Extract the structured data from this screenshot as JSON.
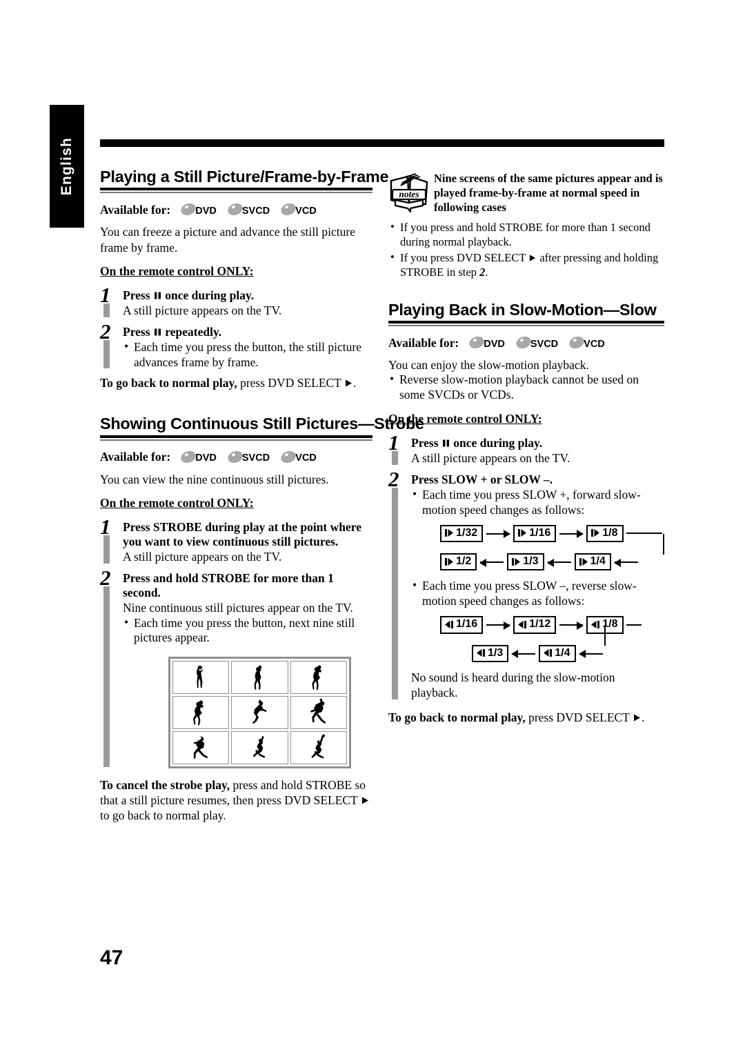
{
  "page": {
    "language_tab": "English",
    "page_number": "47"
  },
  "icons": {
    "disc": "disc-icon",
    "notes": "notes-icon",
    "pause": "pause-icon",
    "play": "play-triangle-icon",
    "slow_forward": "slow-forward-icon",
    "slow_reverse": "slow-reverse-icon"
  },
  "left_column": {
    "section1": {
      "heading": "Playing a Still Picture/Frame-by-Frame",
      "available_label": "Available for:",
      "available_discs": [
        "DVD",
        "SVCD",
        "VCD"
      ],
      "intro": "You can freeze a picture and advance the still picture frame by frame.",
      "remote_only": "On the remote control ONLY:",
      "steps": [
        {
          "num": "1",
          "title_pre": "Press ",
          "title_post": " once during play.",
          "sub": "A still picture appears on the TV.",
          "bullets": []
        },
        {
          "num": "2",
          "title_pre": "Press ",
          "title_post": " repeatedly.",
          "sub": "",
          "bullets": [
            "Each time you press the button, the still picture advances frame by frame."
          ]
        }
      ],
      "footnote_bold": "To go back to normal play,",
      "footnote_rest_pre": " press DVD SELECT ",
      "footnote_rest_post": "."
    },
    "section2": {
      "heading": "Showing Continuous Still Pictures—Strobe",
      "available_label": "Available for:",
      "available_discs": [
        "DVD",
        "SVCD",
        "VCD"
      ],
      "intro": "You can view the nine continuous still pictures.",
      "remote_only": "On the remote control ONLY:",
      "steps": [
        {
          "num": "1",
          "title": "Press STROBE during play at the point where you want to view continuous still pictures.",
          "sub": "A still picture appears on the TV.",
          "bullets": []
        },
        {
          "num": "2",
          "title": "Press and hold STROBE for more than 1 second.",
          "sub": "Nine continuous still pictures appear on the TV.",
          "bullets": [
            "Each time you press the button, next nine still pictures appear."
          ]
        }
      ],
      "strobe_grid": {
        "caption": "nine-frame-strobe-illustration",
        "frames": 9,
        "subject": "baseball pitcher motion sequence"
      },
      "cancel_bold": "To cancel the strobe play,",
      "cancel_rest_pre": " press and hold STROBE so that a still picture resumes, then press DVD SELECT ",
      "cancel_rest_post": " to go back to normal play."
    }
  },
  "right_column": {
    "notes": {
      "badge": "notes",
      "heading": "Nine screens of the same pictures appear and is played frame-by-frame at normal speed in following cases",
      "bullets": [
        {
          "pre": "If you press and hold STROBE for more than 1 second during normal playback.",
          "post": ""
        },
        {
          "pre": "If you press DVD SELECT ",
          "mid": " after pressing and holding STROBE in step ",
          "step_ref": "2",
          "post": "."
        }
      ]
    },
    "section3": {
      "heading": "Playing Back in Slow-Motion—Slow",
      "available_label": "Available for:",
      "available_discs": [
        "DVD",
        "SVCD",
        "VCD"
      ],
      "intro": "You can enjoy the slow-motion playback.",
      "intro_bullets": [
        "Reverse slow-motion playback cannot be used on some SVCDs or VCDs."
      ],
      "remote_only": "On the remote control ONLY:",
      "steps": [
        {
          "num": "1",
          "title_pre": "Press ",
          "title_post": " once during play.",
          "sub": "A still picture appears on the TV.",
          "bullets": []
        },
        {
          "num": "2",
          "title": "Press SLOW + or SLOW –.",
          "bullet_forward": "Each time you press SLOW +, forward slow-motion speed changes as follows:",
          "bullet_reverse": "Each time you press SLOW –, reverse slow-motion speed changes as follows:",
          "sub_end": "No sound is heard during the slow-motion playback."
        }
      ],
      "forward_speeds": [
        "1/32",
        "1/16",
        "1/8",
        "1/4",
        "1/3",
        "1/2"
      ],
      "reverse_speeds": [
        "1/16",
        "1/12",
        "1/8",
        "1/4",
        "1/3"
      ],
      "footnote_bold": "To go back to normal play,",
      "footnote_rest_pre": " press DVD SELECT ",
      "footnote_rest_post": "."
    }
  }
}
